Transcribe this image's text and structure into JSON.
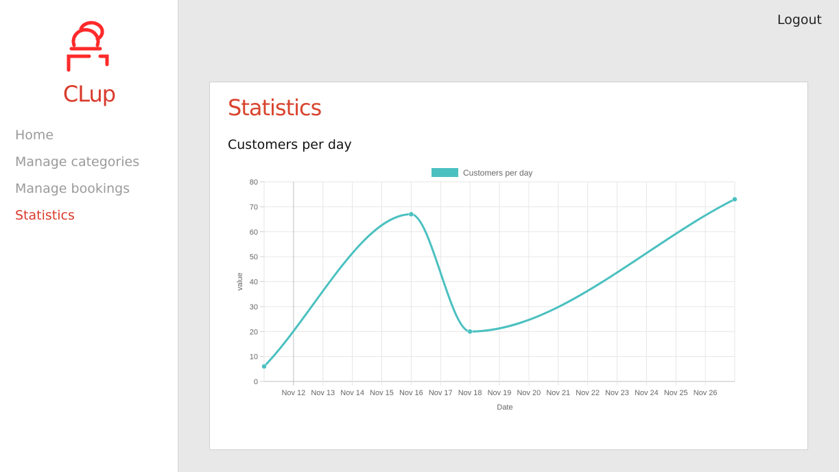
{
  "app": {
    "brand": "CLup",
    "logout_label": "Logout"
  },
  "sidebar": {
    "items": [
      {
        "label": "Home",
        "active": false
      },
      {
        "label": "Manage categories",
        "active": false
      },
      {
        "label": "Manage bookings",
        "active": false
      },
      {
        "label": "Statistics",
        "active": true
      }
    ]
  },
  "main": {
    "page_title": "Statistics",
    "section_title": "Customers per day"
  },
  "colors": {
    "accent": "#d93a2b",
    "series": "#4bc0c0",
    "logo": "#ff2a2a"
  },
  "chart_data": {
    "type": "line",
    "title": "",
    "legend": "top-center",
    "grid": true,
    "xlabel": "Date",
    "ylabel": "value",
    "ylim": [
      0,
      80
    ],
    "yticks": [
      0,
      10,
      20,
      30,
      40,
      50,
      60,
      70,
      80
    ],
    "xlim": [
      "2020-11-11",
      "2020-11-27"
    ],
    "x_tick_labels": [
      "Nov 12",
      "Nov 13",
      "Nov 14",
      "Nov 15",
      "Nov 16",
      "Nov 17",
      "Nov 18",
      "Nov 19",
      "Nov 20",
      "Nov 21",
      "Nov 22",
      "Nov 23",
      "Nov 24",
      "Nov 25",
      "Nov 26"
    ],
    "series": [
      {
        "name": "Customers per day",
        "color": "#4bc0c0",
        "points": [
          {
            "x": "2020-11-11",
            "y": 6
          },
          {
            "x": "2020-11-16",
            "y": 67
          },
          {
            "x": "2020-11-18",
            "y": 20
          },
          {
            "x": "2020-11-27",
            "y": 73
          }
        ]
      }
    ]
  }
}
